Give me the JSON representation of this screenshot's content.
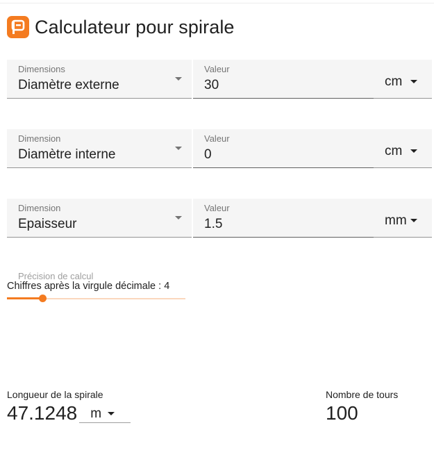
{
  "app": {
    "title": "Calculateur pour spirale",
    "accent_color": "#f47b20"
  },
  "rows": [
    {
      "dimension_label": "Dimensions",
      "dimension_value": "Diamètre externe",
      "value_label": "Valeur",
      "value": "30",
      "unit": "cm"
    },
    {
      "dimension_label": "Dimension",
      "dimension_value": "Diamètre interne",
      "value_label": "Valeur",
      "value": "0",
      "unit": "cm"
    },
    {
      "dimension_label": "Dimension",
      "dimension_value": "Epaisseur",
      "value_label": "Valeur",
      "value": "1.5",
      "unit": "mm"
    }
  ],
  "precision": {
    "label": "Précision de calcul",
    "slider_label": "Chiffres après la virgule décimale : 4",
    "value": 4,
    "min": 0,
    "max": 20
  },
  "results": {
    "length_label": "Longueur de la spirale",
    "length_value": "47.1248",
    "length_unit": "m",
    "turns_label": "Nombre de tours",
    "turns_value": "100"
  }
}
